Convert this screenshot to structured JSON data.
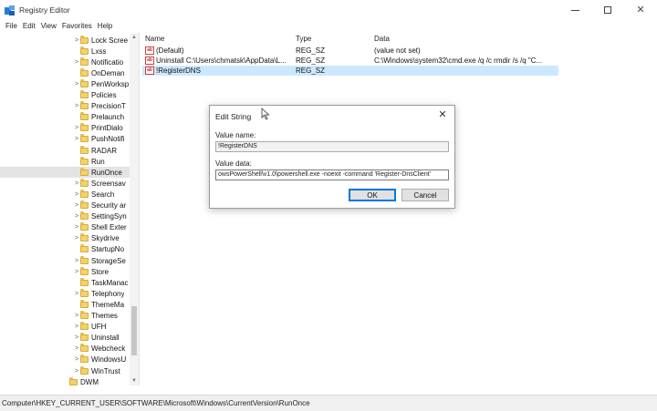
{
  "window": {
    "title": "Registry Editor",
    "menu": [
      "File",
      "Edit",
      "View",
      "Favorites",
      "Help"
    ]
  },
  "tree": {
    "items": [
      {
        "label": "Lock Scree",
        "expandable": true,
        "selected": false
      },
      {
        "label": "Lxss",
        "expandable": false,
        "selected": false
      },
      {
        "label": "Notificatio",
        "expandable": true,
        "selected": false
      },
      {
        "label": "OnDeman",
        "expandable": false,
        "selected": false
      },
      {
        "label": "PenWorksp",
        "expandable": true,
        "selected": false
      },
      {
        "label": "Policies",
        "expandable": false,
        "selected": false
      },
      {
        "label": "PrecisionT",
        "expandable": true,
        "selected": false
      },
      {
        "label": "Prelaunch",
        "expandable": false,
        "selected": false
      },
      {
        "label": "PrintDialo",
        "expandable": true,
        "selected": false
      },
      {
        "label": "PushNotifi",
        "expandable": true,
        "selected": false
      },
      {
        "label": "RADAR",
        "expandable": false,
        "selected": false
      },
      {
        "label": "Run",
        "expandable": false,
        "selected": false
      },
      {
        "label": "RunOnce",
        "expandable": false,
        "selected": true
      },
      {
        "label": "Screensav",
        "expandable": true,
        "selected": false
      },
      {
        "label": "Search",
        "expandable": true,
        "selected": false
      },
      {
        "label": "Security ar",
        "expandable": true,
        "selected": false
      },
      {
        "label": "SettingSyn",
        "expandable": true,
        "selected": false
      },
      {
        "label": "Shell Exter",
        "expandable": true,
        "selected": false
      },
      {
        "label": "Skydrive",
        "expandable": true,
        "selected": false
      },
      {
        "label": "StartupNo",
        "expandable": false,
        "selected": false
      },
      {
        "label": "StorageSe",
        "expandable": true,
        "selected": false
      },
      {
        "label": "Store",
        "expandable": true,
        "selected": false
      },
      {
        "label": "TaskManac",
        "expandable": false,
        "selected": false
      },
      {
        "label": "Telephony",
        "expandable": true,
        "selected": false
      },
      {
        "label": "ThemeMa",
        "expandable": false,
        "selected": false
      },
      {
        "label": "Themes",
        "expandable": true,
        "selected": false
      },
      {
        "label": "UFH",
        "expandable": true,
        "selected": false
      },
      {
        "label": "Uninstall",
        "expandable": true,
        "selected": false
      },
      {
        "label": "Webcheck",
        "expandable": true,
        "selected": false
      },
      {
        "label": "WindowsU",
        "expandable": true,
        "selected": false
      },
      {
        "label": "WinTrust",
        "expandable": true,
        "selected": false
      },
      {
        "label": "DWM",
        "expandable": false,
        "selected": false
      }
    ]
  },
  "values": {
    "columns": {
      "name": "Name",
      "type": "Type",
      "data": "Data"
    },
    "rows": [
      {
        "icon": "ab",
        "name": "(Default)",
        "type": "REG_SZ",
        "data": "(value not set)",
        "selected": false
      },
      {
        "icon": "ab",
        "name": "Uninstall C:\\Users\\chmatsk\\AppData\\L...",
        "type": "REG_SZ",
        "data": "C:\\Windows\\system32\\cmd.exe /q /c rmdir /s /q \"C...",
        "selected": false
      },
      {
        "icon": "ab",
        "name": "!RegisterDNS",
        "type": "REG_SZ",
        "data": "",
        "selected": true
      }
    ]
  },
  "status": {
    "path": "Computer\\HKEY_CURRENT_USER\\SOFTWARE\\Microsoft\\Windows\\CurrentVersion\\RunOnce"
  },
  "dialog": {
    "title": "Edit String",
    "value_name_label": "Value name:",
    "value_name": "!RegisterDNS",
    "value_data_label": "Value data:",
    "value_data": "owsPowerShell\\v1.0\\powershell.exe -noexit -command 'Register-DnsClient'",
    "ok_label": "OK",
    "cancel_label": "Cancel"
  },
  "colors": {
    "selected_row": "#cce8ff",
    "accent": "#0078d7"
  }
}
